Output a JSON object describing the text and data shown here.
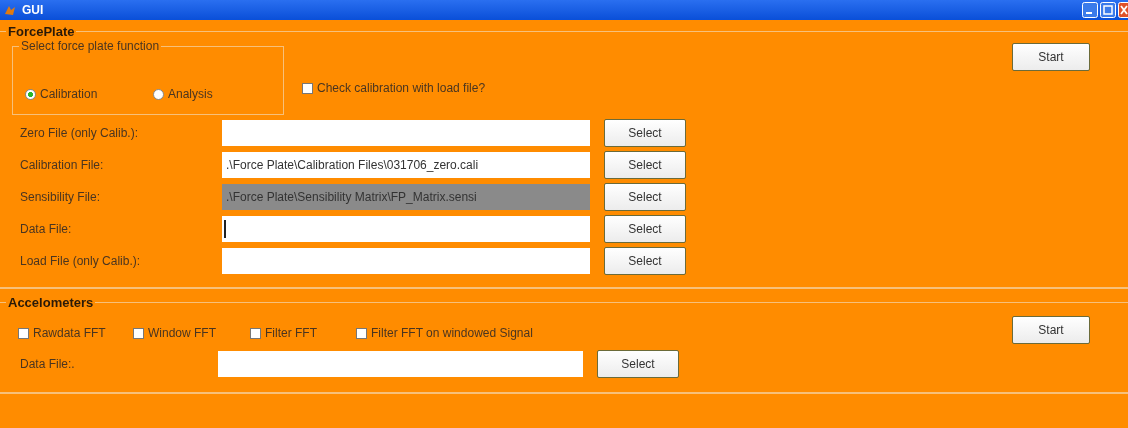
{
  "window": {
    "title": "GUI"
  },
  "force_plate": {
    "title": "ForcePlate",
    "function_group": {
      "title": "Select force plate function",
      "options": [
        {
          "label": "Calibration",
          "selected": true
        },
        {
          "label": "Analysis",
          "selected": false
        }
      ]
    },
    "check_calibration": {
      "label": "Check calibration with load file?",
      "checked": false
    },
    "start_button": "Start",
    "files": [
      {
        "label": "Zero File (only Calib.):",
        "disabled": false,
        "focused": false,
        "button": "Select"
      },
      {
        "label": "Calibration File:",
        "value": ".\\Force Plate\\Calibration Files\\031706_zero.cali",
        "disabled": false,
        "focused": false,
        "button": "Select"
      },
      {
        "label": "Sensibility File:",
        "value": ".\\Force Plate\\Sensibility Matrix\\FP_Matrix.sensi",
        "disabled": true,
        "focused": false,
        "button": "Select"
      },
      {
        "label": "Data File:",
        "disabled": false,
        "focused": true,
        "button": "Select"
      },
      {
        "label": "Load File (only Calib.):",
        "disabled": false,
        "focused": false,
        "button": "Select"
      }
    ]
  },
  "accelometers": {
    "title": "Accelometers",
    "options": [
      {
        "label": "Rawdata FFT",
        "checked": false
      },
      {
        "label": "Window FFT",
        "checked": false
      },
      {
        "label": "Filter FFT",
        "checked": false
      },
      {
        "label": "Filter FFT on windowed Signal",
        "checked": false
      }
    ],
    "start_button": "Start",
    "data_file": {
      "label": "Data File:.",
      "button": "Select"
    }
  }
}
